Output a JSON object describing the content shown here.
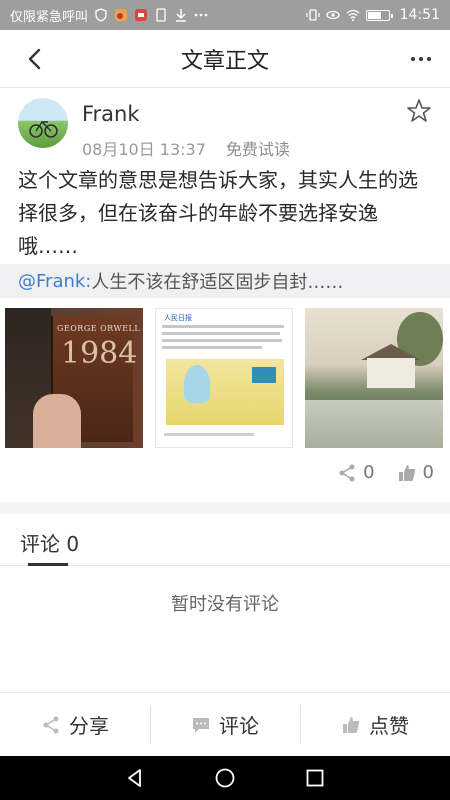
{
  "status_bar": {
    "left_text": "仅限紧急呼叫",
    "time": "14:51",
    "battery_level": 0.6,
    "icons": [
      "shield-icon",
      "weibo-icon",
      "app-icon",
      "sim-icon",
      "download-icon",
      "more-dots-icon",
      "vibrate-icon",
      "eye-icon",
      "wifi-icon",
      "battery-icon"
    ]
  },
  "header": {
    "title": "文章正文",
    "back_icon": "chevron-left-icon",
    "more_icon": "more-dots-icon"
  },
  "post": {
    "author": "Frank",
    "date": "08月10日 13:37",
    "tag": "免费试读",
    "star_icon": "star-outline-icon",
    "content": "这个文章的意思是想告诉大家，其实人生的选择很多，但在该奋斗的年龄不要选择安逸哦……",
    "quote": {
      "mention": "@Frank:",
      "text": "人生不该在舒适区固步自封……"
    },
    "images": [
      {
        "label": "book-1984-image",
        "author_text": "GEORGE ORWELL",
        "number_text": "1984"
      },
      {
        "label": "article-screenshot-image",
        "header_text": "人民日报"
      },
      {
        "label": "landscape-painting-image"
      }
    ],
    "stats": {
      "share_count": "0",
      "like_count": "0"
    }
  },
  "comments": {
    "tab_label": "评论 0",
    "empty_text": "暂时没有评论"
  },
  "actions": {
    "share": "分享",
    "comment": "评论",
    "like": "点赞"
  },
  "colors": {
    "status_bar": "#9e9e9e",
    "mention": "#3b7ec9",
    "quote_bg": "#f0f0f2",
    "navbar": "#000000"
  }
}
